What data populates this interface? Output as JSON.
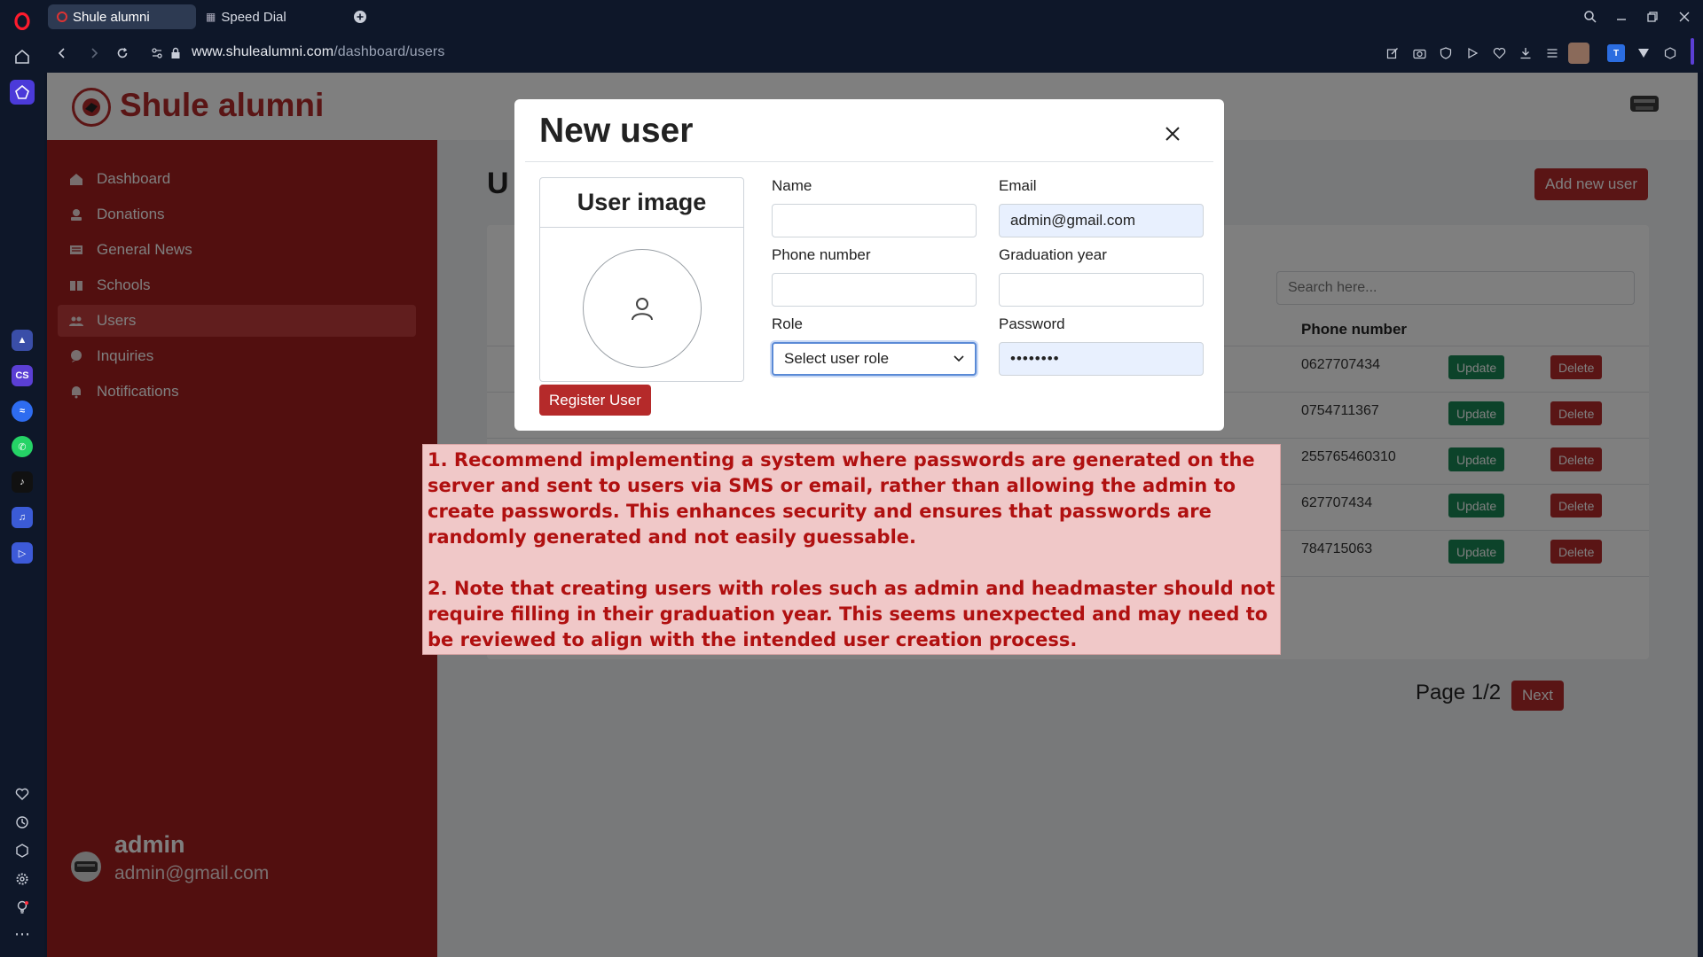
{
  "browser": {
    "tabs": [
      {
        "label": "Shule alumni",
        "active": true
      },
      {
        "label": "Speed Dial",
        "active": false
      }
    ],
    "url_domain": "www.shulealumni.com",
    "url_path": "/dashboard/users"
  },
  "site": {
    "brand": "Shule alumni",
    "accent_color": "#b52a2a"
  },
  "sidebar": {
    "items": [
      {
        "label": "Dashboard",
        "icon": "home-icon"
      },
      {
        "label": "Donations",
        "icon": "donations-icon"
      },
      {
        "label": "General News",
        "icon": "news-icon"
      },
      {
        "label": "Schools",
        "icon": "book-icon"
      },
      {
        "label": "Users",
        "icon": "users-icon",
        "active": true
      },
      {
        "label": "Inquiries",
        "icon": "inquiries-icon"
      },
      {
        "label": "Notifications",
        "icon": "bell-icon"
      }
    ],
    "user": {
      "name": "admin",
      "email": "admin@gmail.com"
    }
  },
  "main": {
    "title": "U",
    "add_user_label": "Add new user",
    "search_placeholder": "Search here...",
    "phone_header": "Phone number",
    "rows": [
      {
        "phone": "0627707434"
      },
      {
        "phone": "0754711367"
      },
      {
        "phone": "255765460310"
      },
      {
        "phone": "627707434"
      },
      {
        "phone": "784715063"
      }
    ],
    "update_label": "Update",
    "delete_label": "Delete",
    "page_indicator": "Page 1/2",
    "next_label": "Next"
  },
  "modal": {
    "title": "New user",
    "image_card_title": "User image",
    "register_label": "Register User",
    "fields": {
      "name": {
        "label": "Name",
        "value": ""
      },
      "email": {
        "label": "Email",
        "value": "admin@gmail.com"
      },
      "phone": {
        "label": "Phone number",
        "value": ""
      },
      "graduation_year": {
        "label": "Graduation year",
        "value": ""
      },
      "role": {
        "label": "Role",
        "value": "Select user role"
      },
      "password": {
        "label": "Password",
        "value": "••••••••"
      }
    }
  },
  "annotation": {
    "point1": "1. Recommend implementing a system where passwords are generated on the server and sent to users via SMS or email, rather than allowing the admin to create passwords. This enhances security and ensures that passwords are randomly generated and not easily guessable.",
    "point2": "2. Note that creating users with roles such as admin and headmaster should not require filling in their graduation year. This seems unexpected and may need to be reviewed to align with the intended user creation process."
  }
}
